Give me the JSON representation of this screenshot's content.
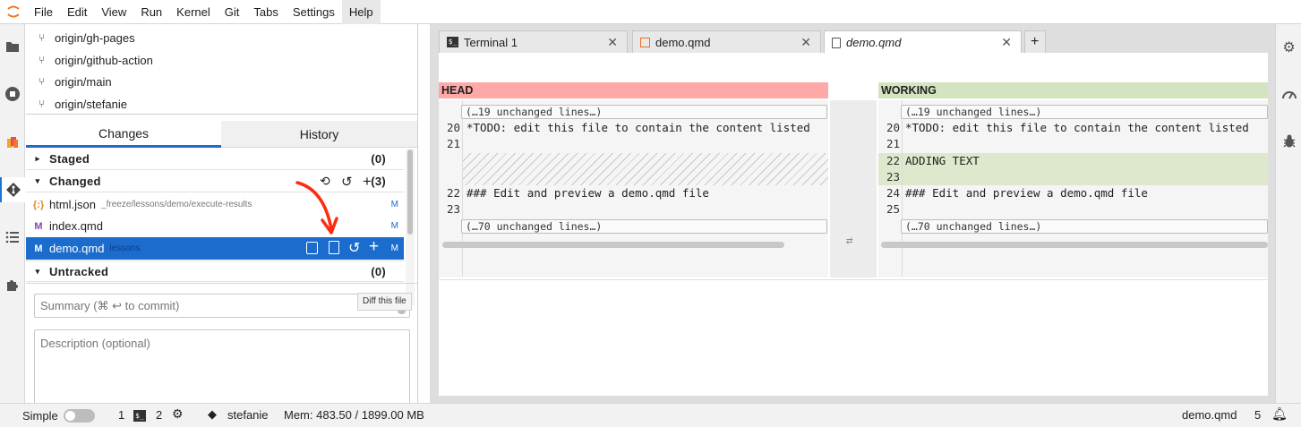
{
  "menubar": {
    "items": [
      "File",
      "Edit",
      "View",
      "Run",
      "Kernel",
      "Git",
      "Tabs",
      "Settings",
      "Help"
    ],
    "active": "Help"
  },
  "git_panel": {
    "branches": [
      "origin/gh-pages",
      "origin/github-action",
      "origin/main",
      "origin/stefanie"
    ],
    "tabs": [
      "Changes",
      "History"
    ],
    "active_tab": "Changes",
    "staged": {
      "label": "Staged",
      "count": "(0)"
    },
    "changed": {
      "label": "Changed",
      "count": "(3)"
    },
    "files": [
      {
        "name": "html.json",
        "path": "_freeze/lessons/demo/execute-results",
        "status": "M",
        "icon": "{:}"
      },
      {
        "name": "index.qmd",
        "path": "",
        "status": "M",
        "icon": "M"
      },
      {
        "name": "demo.qmd",
        "path": "lessons",
        "status": "M",
        "icon": "M"
      }
    ],
    "untracked": {
      "label": "Untracked",
      "count": "(0)"
    },
    "tooltip": "Diff this file",
    "summary_placeholder": "Summary (⌘ ↩ to commit)",
    "description_placeholder": "Description (optional)"
  },
  "doc_tabs": [
    {
      "label": "Terminal 1",
      "icon": "terminal-icon"
    },
    {
      "label": "demo.qmd",
      "icon": "markdown-icon"
    },
    {
      "label": "demo.qmd",
      "icon": "file-icon"
    }
  ],
  "diff": {
    "left_header": "HEAD",
    "right_header": "WORKING",
    "collapsed_top": "(…19 unchanged lines…)",
    "collapsed_bottom": "(…70 unchanged lines…)",
    "left_lines": [
      {
        "n": "20",
        "text": "*TODO: edit this file to contain the content listed"
      },
      {
        "n": "21",
        "text": ""
      },
      {
        "n": "22",
        "text": "### Edit and preview a demo.qmd file"
      },
      {
        "n": "23",
        "text": ""
      }
    ],
    "right_lines": [
      {
        "n": "20",
        "text": "*TODO: edit this file to contain the content listed"
      },
      {
        "n": "21",
        "text": ""
      },
      {
        "n": "22",
        "text": "ADDING TEXT"
      },
      {
        "n": "23",
        "text": ""
      },
      {
        "n": "24",
        "text": "### Edit and preview a demo.qmd file"
      },
      {
        "n": "25",
        "text": ""
      }
    ]
  },
  "statusbar": {
    "mode": "Simple",
    "terminals": "1",
    "kernels": "2",
    "branch": "stefanie",
    "memory": "Mem: 483.50 / 1899.00 MB",
    "filename": "demo.qmd",
    "line": "5"
  },
  "colors": {
    "accent": "#1b6ccd",
    "head_header": "#ffa8a8",
    "working_header": "#d4e3c0",
    "added_line": "#dde8cd",
    "annotation_arrow": "#ff2a12"
  }
}
